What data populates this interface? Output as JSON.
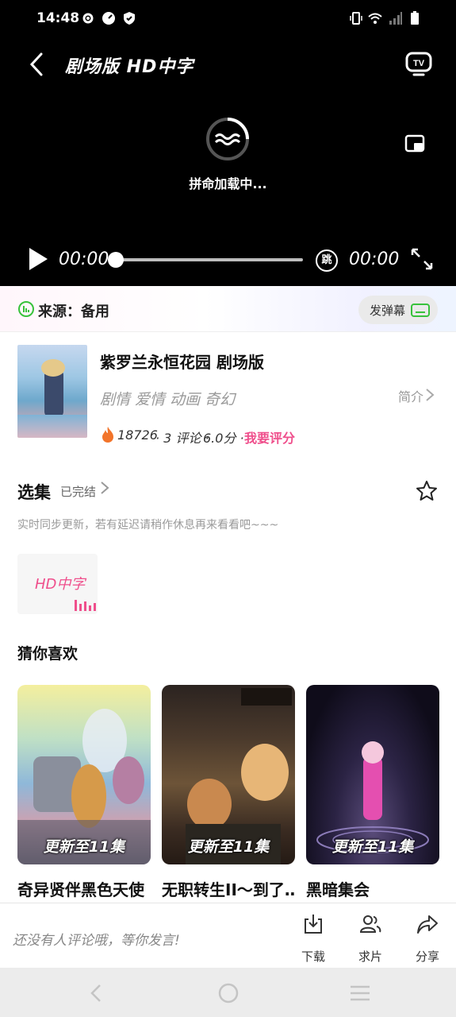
{
  "status_bar": {
    "time": "14:48"
  },
  "player": {
    "title": "剧场版  HD中字",
    "loading_text": "拼命加载中...",
    "current_time": "00:00",
    "total_time": "00:00",
    "skip_label": "跳",
    "progress": 0
  },
  "source": {
    "label": "来源：备用",
    "danmu_label": "发弹幕"
  },
  "anime": {
    "title": "紫罗兰永恒花园 剧场版",
    "tags": "剧情 爱情 动画 奇幻",
    "intro_label": "简介",
    "heat": "18726",
    "comments": "· 3 评论 ·",
    "score": "6.0分 ·",
    "rate_label": "我要评分"
  },
  "episodes": {
    "title": "选集",
    "status": "已完结",
    "note": "实时同步更新，若有延迟请稍作休息再来看看吧~~~",
    "items": [
      {
        "label": "HD中字"
      }
    ]
  },
  "recommend": {
    "title": "猜你喜欢",
    "items": [
      {
        "name": "奇异贤伴黑色天使",
        "badge": "更新至11集"
      },
      {
        "name": "无职转生II～到了…",
        "badge": "更新至11集"
      },
      {
        "name": "黑暗集会",
        "badge": "更新至11集"
      }
    ]
  },
  "bottom": {
    "comment_hint": "还没有人评论哦，等你发言!",
    "actions": [
      {
        "label": "下载",
        "icon": "download-icon"
      },
      {
        "label": "求片",
        "icon": "request-icon"
      },
      {
        "label": "分享",
        "icon": "share-icon"
      }
    ]
  },
  "colors": {
    "accent": "#ef4f8c",
    "danmu_green": "#38c23c"
  }
}
